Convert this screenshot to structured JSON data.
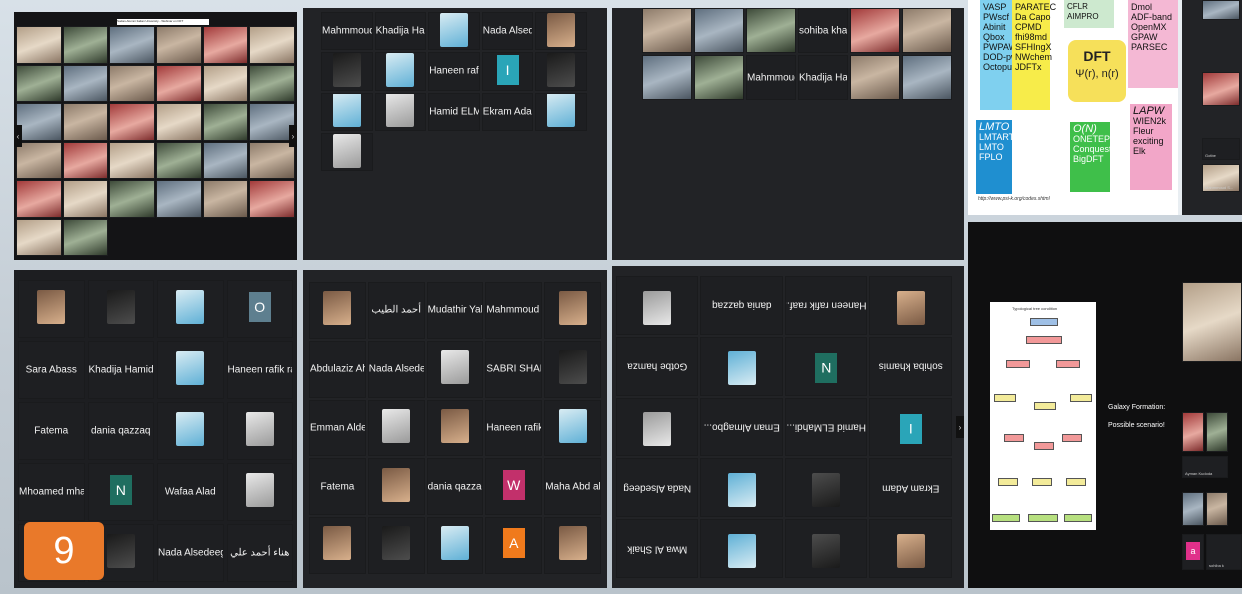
{
  "slide_number": "9",
  "panel1": {
    "banner": "Sudan-Alumni Italian University - Webinar on DFT",
    "names": [
      "",
      "",
      "",
      "",
      "",
      "",
      "",
      "",
      "",
      "",
      "",
      "",
      "",
      "",
      "",
      "",
      "",
      "",
      "",
      "",
      "",
      "",
      "",
      "",
      "",
      "",
      "",
      "",
      "",
      "",
      "",
      ""
    ]
  },
  "panel2": {
    "cards": [
      "Mahmmoud Salih",
      "Khadija Hamid",
      "",
      "Nada Alsedeeg",
      "",
      "",
      "",
      "Haneen rafik raafat",
      "",
      "",
      "",
      "",
      "Hamid ELMahdi ELBas...",
      "Ekram Adam",
      "",
      ""
    ]
  },
  "panel3": {
    "cards": [
      "",
      "",
      "",
      "sohiba khamis",
      "",
      "",
      "",
      "",
      "Mahmmoud Salih",
      "Khadija Hamid",
      "",
      ""
    ]
  },
  "panel4": {
    "slide": {
      "top_left_codes": "VASP\nPWscf\nAbinit\nQbox\nPWPAW\nDOD-pw\nOctopus",
      "top_mid_codes": "PARATEC\nDa Capo\nCPMD\nfhi98md\nSFHIngX\nNWchem\nJDFTx",
      "top_cut": "CFLR\nAIMPRO",
      "right_codes": "Dmol\nADF-band\nOpenMX\nGPAW\nPARSEC",
      "center_title": "DFT",
      "center_formula": "Ψ(r), n(r)",
      "lmto_title": "LMTO",
      "lmto_codes": "LMTART\nLMTO\nFPLO",
      "on_title": "O(N)",
      "on_codes": "ONETEP\nConquest\nBigDFT",
      "lapw_title": "LAPW",
      "lapw_codes": "WIEN2k\nFleur\nexciting\nElk",
      "footer_url": "http://www.psi-k.org/codes.shtml"
    },
    "side_names": [
      "Gotbe",
      "Mahmmoud S..."
    ]
  },
  "panel5": {
    "cards": [
      "",
      "",
      "",
      "",
      "Sara Abass",
      "Khadija Hamid",
      "",
      "Haneen rafik raaf...",
      "Fatema",
      "dania qazzaq",
      "",
      "",
      "Mhoamed mhadi",
      "",
      "Wafaa Alad",
      "",
      "",
      "",
      "Nada Alsedeeg",
      "هناء أحمد علي"
    ]
  },
  "panel6": {
    "cards": [
      "",
      "أحمد الطيب",
      "Mudathir Yahya",
      "Mahmmoud Salih",
      "",
      "Abdulaziz Ahmed",
      "Nada Alsedeeg",
      "",
      "SABRI SHARIF",
      "",
      "Emman Aldeiry",
      "",
      "",
      "Haneen rafik raafat",
      "",
      "Fatema",
      "",
      "dania qazzaq",
      "",
      "Maha Abd alsalam",
      "",
      "",
      "",
      "",
      ""
    ]
  },
  "panel7": {
    "cards": [
      "",
      "",
      "",
      "Mwa Al Shaik",
      "Ekram Adam",
      "",
      "",
      "Nada Alsedeeg",
      "",
      "Hamid ELMahdi...",
      "Eman Almagbo...",
      "",
      "sohiba khamis",
      "",
      "",
      "Gotbe hamza",
      "",
      "Haneen rafik raaf...",
      "dania qazzaq",
      ""
    ]
  },
  "panel8": {
    "flow_title": "Typological tree condition",
    "caption_line1": "Galaxy Formation:",
    "caption_line2": "Possible scenario!",
    "side_names": [
      "Ayman Kudoda",
      "",
      "sohiba k"
    ]
  },
  "colors": {
    "badge": "#e9792a",
    "lmto_box": "#1f8fd0",
    "on_box": "#3fbf4a",
    "lapw_box": "#f2a6c8",
    "dft_box": "#f6e05a",
    "top_left_box": "#7fd0ef",
    "top_mid_box": "#f7ec4a",
    "right_box": "#f4b8d4"
  }
}
